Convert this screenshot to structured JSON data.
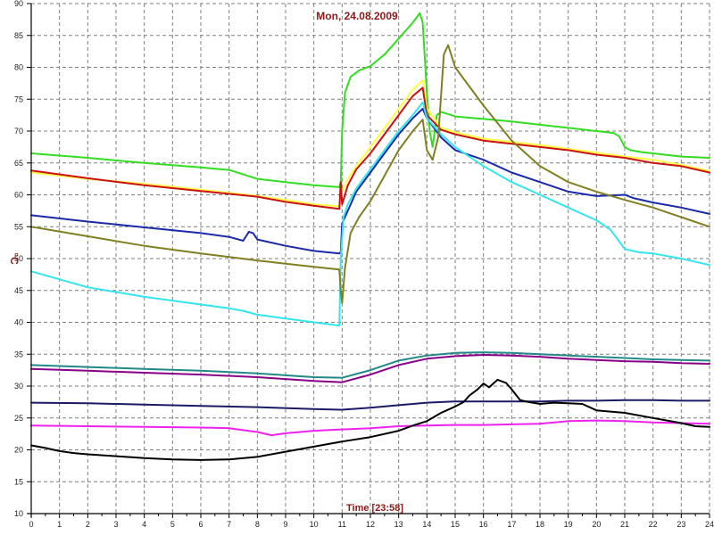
{
  "chart_data": {
    "type": "line",
    "title": "Mon, 24.08.2009",
    "xlabel": "Time [23:58]",
    "ylabel": "°C",
    "xlim": [
      0,
      24
    ],
    "ylim": [
      10,
      90
    ],
    "x_ticks": [
      "0",
      "1",
      "2",
      "3",
      "4",
      "5",
      "6",
      "7",
      "8",
      "9",
      "10",
      "11",
      "12",
      "13",
      "14",
      "15",
      "16",
      "17",
      "18",
      "19",
      "20",
      "21",
      "22",
      "23",
      "24"
    ],
    "y_ticks": [
      "10",
      "15",
      "20",
      "25",
      "30",
      "35",
      "40",
      "45",
      "50",
      "55",
      "60",
      "65",
      "70",
      "75",
      "80",
      "85",
      "90"
    ],
    "grid": true,
    "colors": {
      "grid": "#7f7f7f",
      "title": "#8b1a1a",
      "axis_label": "#8b1a1a",
      "series": [
        "#33dd22",
        "#ffff44",
        "#cc1111",
        "#1a2aa8",
        "#33e5ee",
        "#808022",
        "#228888",
        "#880088",
        "#1a1a66",
        "#ee22ee",
        "#000000"
      ]
    },
    "series": [
      {
        "x": [
          0,
          2,
          4,
          6,
          7,
          7.5,
          8,
          9,
          10,
          10.9,
          10.95,
          11.0,
          11.1,
          11.3,
          11.6,
          12,
          12.5,
          13,
          13.5,
          13.75,
          13.85,
          14.0,
          14.1,
          14.2,
          14.35,
          14.5,
          14.8,
          15,
          16,
          17,
          18,
          19,
          20,
          20.6,
          20.8,
          21.0,
          21.2,
          21.6,
          22,
          23,
          24
        ],
        "y": [
          66.5,
          65.8,
          65,
          64.3,
          63.9,
          63.2,
          62.5,
          62.0,
          61.5,
          61.2,
          62.0,
          70,
          76,
          78.5,
          79.5,
          80.2,
          82,
          84.5,
          87,
          88.5,
          87,
          76,
          70,
          67.5,
          72.5,
          73,
          72.6,
          72.3,
          71.9,
          71.5,
          71,
          70.5,
          70.0,
          69.7,
          69.2,
          67.5,
          67.0,
          66.7,
          66.5,
          66.0,
          65.8
        ]
      },
      {
        "x": [
          0,
          2,
          4,
          6,
          8,
          9,
          10,
          10.9,
          11.0,
          11.2,
          11.5,
          12,
          12.5,
          13,
          13.5,
          13.85,
          14.0,
          14.5,
          15,
          16,
          17,
          18,
          19,
          20,
          21,
          22,
          23,
          24
        ],
        "y": [
          63.5,
          62.5,
          61.7,
          60.8,
          59.8,
          59.2,
          58.5,
          58.2,
          60.5,
          62.5,
          64.5,
          67.5,
          70.5,
          73.5,
          76.5,
          78.0,
          73.5,
          70.5,
          69.8,
          68.8,
          68.3,
          67.8,
          67.2,
          66.6,
          66.0,
          65.5,
          64.7,
          63.7
        ]
      },
      {
        "x": [
          0,
          2,
          4,
          6,
          8,
          9,
          10,
          10.9,
          10.95,
          11.0,
          11.1,
          11.2,
          11.5,
          12,
          12.5,
          13,
          13.5,
          13.85,
          14.0,
          14.5,
          15,
          16,
          17,
          18,
          19,
          20,
          21,
          22,
          23,
          24
        ],
        "y": [
          63.8,
          62.6,
          61.5,
          60.6,
          59.7,
          58.9,
          58.3,
          57.8,
          62.0,
          58.5,
          60.0,
          61.5,
          64.0,
          66.5,
          69.5,
          72.5,
          75.5,
          76.8,
          72.5,
          70.2,
          69.5,
          68.5,
          68.0,
          67.5,
          67.0,
          66.3,
          65.8,
          65.0,
          64.5,
          63.5
        ]
      },
      {
        "x": [
          0,
          2,
          4,
          6,
          7,
          7.5,
          7.7,
          7.85,
          8,
          8.5,
          9,
          10,
          10.9,
          10.95,
          11.0,
          11.2,
          11.5,
          12,
          12.5,
          13,
          13.5,
          13.85,
          14.0,
          14.5,
          15,
          16,
          17,
          18,
          19,
          20,
          21,
          21.3,
          22,
          23,
          24
        ],
        "y": [
          56.8,
          55.8,
          54.9,
          54.0,
          53.4,
          52.8,
          54.2,
          54.0,
          53.0,
          52.5,
          52.0,
          51.2,
          50.8,
          51.0,
          55.5,
          57.5,
          60.5,
          63.5,
          66.5,
          69.5,
          72.0,
          73.5,
          72.0,
          69.0,
          67.0,
          65.5,
          63.5,
          62.0,
          60.5,
          59.8,
          60.0,
          59.5,
          58.8,
          58.0,
          57.0
        ]
      },
      {
        "x": [
          0,
          2,
          4,
          6,
          7,
          7.5,
          8,
          9,
          10,
          10.9,
          10.95,
          11.05,
          11.2,
          11.5,
          12,
          12.5,
          13,
          13.5,
          13.85,
          14.0,
          14.5,
          15,
          16,
          17,
          18,
          19,
          20,
          20.5,
          21,
          21.5,
          22,
          23,
          24
        ],
        "y": [
          48.0,
          45.5,
          44.0,
          42.8,
          42.2,
          41.8,
          41.2,
          40.6,
          40.0,
          39.5,
          50,
          56.5,
          58.5,
          61.0,
          64.0,
          67.0,
          70.0,
          72.5,
          74.5,
          72.0,
          69.5,
          67.5,
          64.5,
          62.0,
          60.0,
          58.0,
          56.0,
          54.5,
          51.5,
          51.0,
          50.8,
          50.0,
          49.0
        ]
      },
      {
        "x": [
          0,
          2,
          4,
          6,
          8,
          9,
          10,
          10.9,
          10.95,
          11.0,
          11.1,
          11.3,
          11.6,
          12,
          12.5,
          13,
          13.5,
          13.85,
          14.0,
          14.2,
          14.4,
          14.6,
          14.75,
          15,
          15.5,
          16,
          17,
          18,
          19,
          20,
          21,
          22,
          23,
          24
        ],
        "y": [
          55.0,
          53.5,
          52.0,
          50.8,
          49.7,
          49.2,
          48.7,
          48.3,
          45.0,
          43.0,
          48.5,
          54.0,
          56.5,
          59.0,
          63.0,
          67.0,
          70.0,
          71.8,
          67.0,
          65.5,
          69.0,
          82.0,
          83.5,
          80.0,
          77.0,
          74.0,
          68.5,
          64.5,
          62.0,
          60.5,
          59.2,
          58.0,
          56.5,
          55.0
        ]
      },
      {
        "x": [
          0,
          2,
          4,
          6,
          8,
          10,
          11,
          12,
          13,
          14,
          15,
          16,
          17,
          18,
          19,
          20,
          21,
          22,
          23,
          24
        ],
        "y": [
          33.3,
          33.0,
          32.7,
          32.4,
          32.0,
          31.4,
          31.3,
          32.5,
          34.0,
          34.8,
          35.2,
          35.3,
          35.2,
          35.0,
          34.8,
          34.6,
          34.4,
          34.2,
          34.1,
          34.0
        ]
      },
      {
        "x": [
          0,
          2,
          4,
          6,
          8,
          10,
          11,
          12,
          13,
          14,
          15,
          16,
          17,
          18,
          19,
          20,
          21,
          22,
          23,
          24
        ],
        "y": [
          32.7,
          32.4,
          32.1,
          31.8,
          31.4,
          30.8,
          30.6,
          31.8,
          33.3,
          34.3,
          34.7,
          34.9,
          34.8,
          34.6,
          34.3,
          34.1,
          33.9,
          33.8,
          33.6,
          33.5
        ]
      },
      {
        "x": [
          0,
          2,
          4,
          6,
          8,
          10,
          11,
          12,
          13,
          14,
          15,
          16,
          17,
          18,
          19,
          20,
          21,
          22,
          23,
          24
        ],
        "y": [
          27.4,
          27.3,
          27.1,
          26.9,
          26.7,
          26.4,
          26.3,
          26.6,
          27.0,
          27.4,
          27.6,
          27.6,
          27.6,
          27.6,
          27.7,
          27.7,
          27.8,
          27.8,
          27.7,
          27.7
        ]
      },
      {
        "x": [
          0,
          2,
          4,
          6,
          7,
          8,
          8.5,
          9,
          10,
          11,
          12,
          13,
          14,
          15,
          16,
          17,
          18,
          18.5,
          19,
          20,
          21,
          22,
          23,
          24
        ],
        "y": [
          23.8,
          23.7,
          23.6,
          23.5,
          23.4,
          22.8,
          22.3,
          22.6,
          23.0,
          23.2,
          23.4,
          23.7,
          23.8,
          23.9,
          23.9,
          24.0,
          24.1,
          24.3,
          24.5,
          24.6,
          24.5,
          24.3,
          24.2,
          24.1
        ]
      },
      {
        "x": [
          0,
          0.5,
          1,
          1.5,
          2,
          3,
          4,
          5,
          6,
          7,
          8,
          9,
          10,
          11,
          12,
          13,
          13.5,
          14,
          14.5,
          15,
          15.3,
          15.5,
          15.8,
          16,
          16.2,
          16.5,
          16.8,
          17,
          17.3,
          17.6,
          18,
          18.5,
          19,
          19.5,
          20,
          21,
          22,
          23,
          23.5,
          24
        ],
        "y": [
          20.7,
          20.3,
          19.8,
          19.5,
          19.3,
          19.0,
          18.7,
          18.5,
          18.4,
          18.5,
          18.9,
          19.7,
          20.5,
          21.3,
          22.0,
          23.0,
          23.8,
          24.5,
          25.8,
          26.8,
          27.5,
          28.5,
          29.5,
          30.4,
          29.8,
          31.0,
          30.5,
          29.5,
          27.8,
          27.5,
          27.2,
          27.4,
          27.3,
          27.2,
          26.2,
          25.8,
          25.0,
          24.2,
          23.7,
          23.6
        ]
      }
    ]
  }
}
